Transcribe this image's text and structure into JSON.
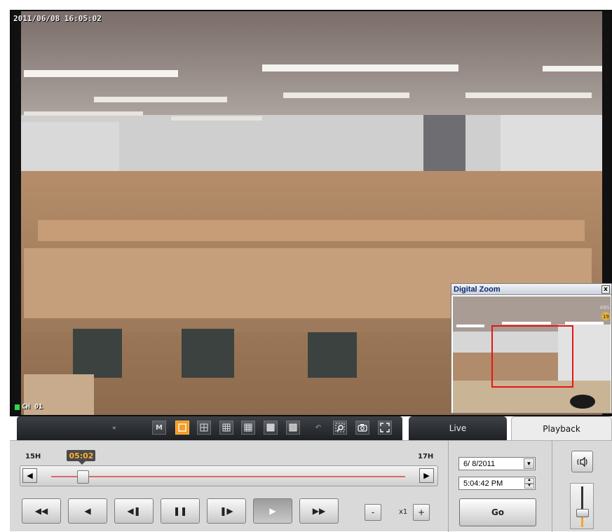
{
  "video": {
    "timestamp": "2011/06/08 16:05:02",
    "channel": "CH 01"
  },
  "digital_zoom": {
    "title": "Digital Zoom",
    "close_label": "x",
    "watermark": "KBS",
    "watermark_num": "19"
  },
  "toolbar": {
    "buttons": [
      {
        "name": "record-icon",
        "label": "",
        "state": "disabled"
      },
      {
        "name": "mode-m-button",
        "label": "M",
        "state": "normal"
      },
      {
        "name": "layout-1-button",
        "label": "",
        "state": "active"
      },
      {
        "name": "layout-4-button",
        "label": "",
        "state": "normal"
      },
      {
        "name": "layout-9-button",
        "label": "",
        "state": "normal"
      },
      {
        "name": "layout-16-button",
        "label": "",
        "state": "normal"
      },
      {
        "name": "layout-25-button",
        "label": "",
        "state": "normal"
      },
      {
        "name": "layout-36-button",
        "label": "",
        "state": "normal"
      },
      {
        "name": "undo-icon",
        "label": "",
        "state": "disabled"
      },
      {
        "name": "digital-zoom-icon",
        "label": "",
        "state": "normal"
      },
      {
        "name": "snapshot-icon",
        "label": "",
        "state": "normal"
      },
      {
        "name": "fullscreen-icon",
        "label": "",
        "state": "normal"
      }
    ]
  },
  "tabs": {
    "live": "Live",
    "playback": "Playback",
    "selected": "playback"
  },
  "timeline": {
    "start_label": "15H",
    "end_label": "17H",
    "current_time": "05:02",
    "position": 0.09
  },
  "controls": {
    "buttons": [
      {
        "name": "rewind-fast-button",
        "glyph": "◀◀"
      },
      {
        "name": "reverse-play-button",
        "glyph": "◀"
      },
      {
        "name": "step-back-button",
        "glyph": "◀❚"
      },
      {
        "name": "pause-button",
        "glyph": "❚❚"
      },
      {
        "name": "step-forward-button",
        "glyph": "❚▶"
      },
      {
        "name": "play-button",
        "glyph": "▶",
        "pressed": true
      },
      {
        "name": "fast-forward-button",
        "glyph": "▶▶"
      }
    ],
    "speed_minus": "-",
    "speed_label": "x1",
    "speed_plus": "+"
  },
  "search": {
    "date": "6/ 8/2011",
    "time": "5:04:42 PM",
    "go_label": "Go"
  },
  "audio": {
    "volume": 0.35,
    "accent": "#f5a623"
  },
  "colors": {
    "active_layout": "#f59b1f",
    "time_text": "#ffb030",
    "timeline_track": "#d86a6a",
    "channel_indicator": "#2ed64b"
  }
}
